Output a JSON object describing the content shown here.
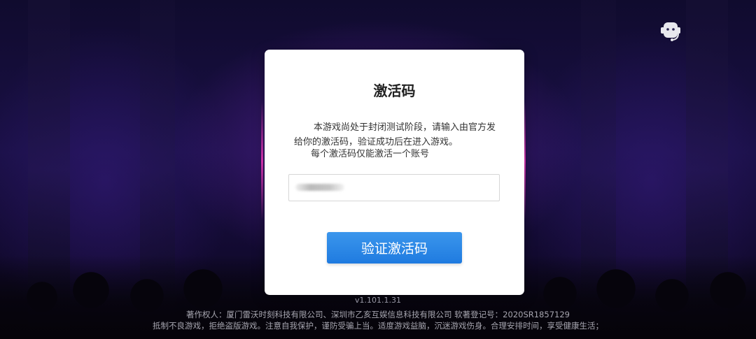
{
  "dialog": {
    "title": "激活码",
    "description": "本游戏尚处于封闭测试阶段，请输入由官方发给你的激活码，验证成功后在进入游戏。",
    "note": "每个激活码仅能激活一个账号",
    "input": {
      "value": "",
      "placeholder": ""
    },
    "verify_button": "验证激活码"
  },
  "footer": {
    "version": "v1.101.1.31",
    "copyright": "著作权人：厦门雷沃时刻科技有限公司、深圳市乙亥互娱信息科技有限公司 软著登记号：2020SR1857129",
    "advisory": "抵制不良游戏，拒绝盗版游戏。注意自我保护，谨防受骗上当。适度游戏益脑，沉迷游戏伤身。合理安排时间，享受健康生活；"
  },
  "colors": {
    "button": "#2a87e6",
    "dialog_bg": "#ffffff",
    "background": "#120a30"
  },
  "icons": {
    "support": "customer-service-icon"
  }
}
